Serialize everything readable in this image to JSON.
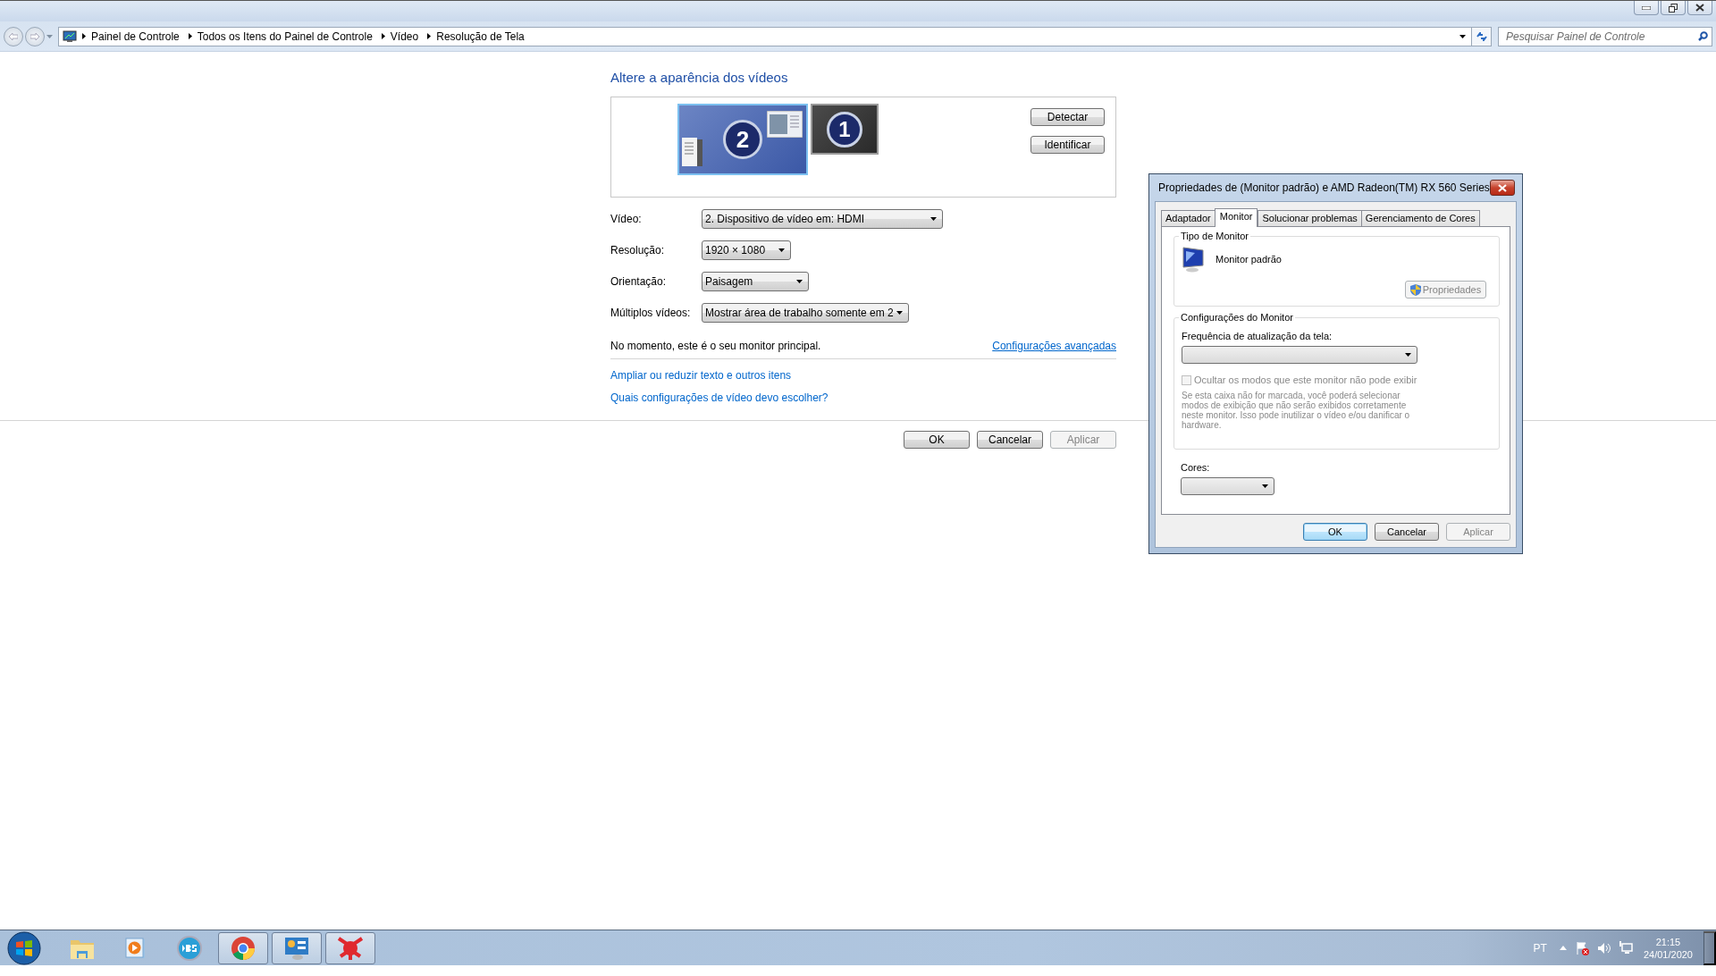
{
  "address_bar": {
    "breadcrumbs": [
      "Painel de Controle",
      "Todos os Itens do Painel de Controle",
      "Vídeo",
      "Resolução de Tela"
    ]
  },
  "search": {
    "placeholder": "Pesquisar Painel de Controle"
  },
  "page": {
    "title": "Altere a aparência dos vídeos",
    "monitors": [
      {
        "number": "2",
        "selected": true
      },
      {
        "number": "1",
        "selected": false
      }
    ],
    "side_buttons": [
      "Detectar",
      "Identificar"
    ],
    "settings": [
      {
        "label": "Vídeo:",
        "value": "2. Dispositivo de vídeo em: HDMI"
      },
      {
        "label": "Resolução:",
        "value": "1920 × 1080"
      },
      {
        "label": "Orientação:",
        "value": "Paisagem"
      },
      {
        "label": "Múltiplos vídeos:",
        "value": "Mostrar área de trabalho somente em 2"
      }
    ],
    "status": "No momento, este é o seu monitor principal.",
    "advanced_link": "Configurações avançadas",
    "links": [
      "Ampliar ou reduzir texto e outros itens",
      "Quais configurações de vídeo devo escolher?"
    ]
  },
  "buttons": [
    {
      "label": "OK",
      "disabled": false
    },
    {
      "label": "Cancelar",
      "disabled": false
    },
    {
      "label": "Aplicar",
      "disabled": true
    }
  ],
  "dialog": {
    "title": "Propriedades de (Monitor padrão) e AMD Radeon(TM) RX 560 Series",
    "tabs": [
      {
        "label": "Adaptador",
        "selected": false
      },
      {
        "label": "Monitor",
        "selected": true
      },
      {
        "label": "Solucionar problemas",
        "selected": false
      },
      {
        "label": "Gerenciamento de Cores",
        "selected": false
      }
    ],
    "monitor_type": {
      "heading": "Tipo de Monitor",
      "name": "Monitor padrão",
      "button": {
        "label": "Propriedades",
        "disabled": true
      }
    },
    "monitor_settings": {
      "heading": "Configurações do Monitor",
      "refresh_label": "Frequência de atualização da tela:",
      "hide_modes": {
        "label": "Ocultar os modos que este monitor não pode exibir",
        "checked": false,
        "disabled": true
      },
      "note": "Se esta caixa não for marcada, você poderá selecionar modos de exibição que não serão exibidos corretamente neste monitor. Isso pode inutilizar o vídeo e/ou danificar o hardware."
    },
    "colors_label": "Cores:",
    "buttons": [
      {
        "label": "OK",
        "default": true,
        "disabled": false
      },
      {
        "label": "Cancelar",
        "default": false,
        "disabled": false
      },
      {
        "label": "Aplicar",
        "default": false,
        "disabled": true
      }
    ]
  },
  "taskbar": {
    "items": [
      {
        "kind": "folder",
        "open": false
      },
      {
        "kind": "media",
        "open": false
      },
      {
        "kind": "bs",
        "open": false
      },
      {
        "kind": "browser",
        "open": true
      },
      {
        "kind": "panel",
        "open": true
      },
      {
        "kind": "star",
        "open": true
      }
    ],
    "language": "PT",
    "time": "21:15",
    "date": "24/01/2020"
  }
}
